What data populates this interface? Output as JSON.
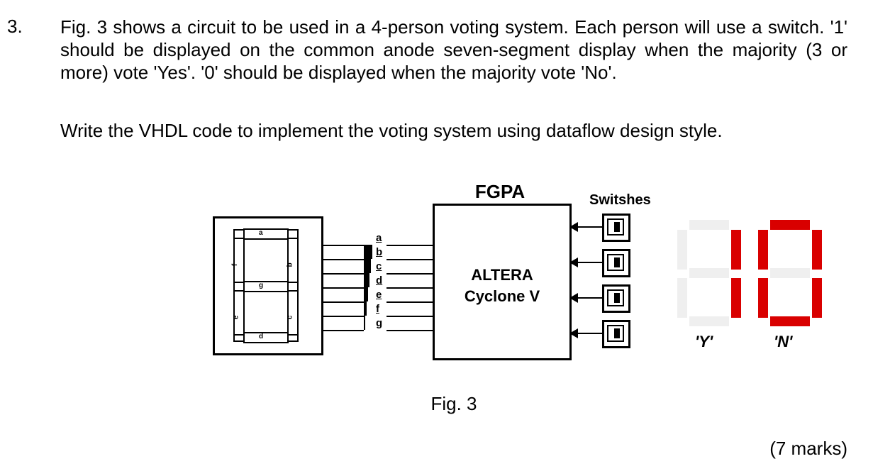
{
  "question": {
    "number": "3.",
    "para1": "Fig. 3 shows a circuit to be used in a 4-person voting system. Each person will use a switch. '1' should be displayed on the common anode seven-segment display when the majority (3 or more) vote 'Yes'. '0' should be displayed when the majority vote 'No'.",
    "para2": "Write the VHDL code to implement the voting system using dataflow design style."
  },
  "diagram": {
    "fpga_label": "FGPA",
    "fpga_line1": "ALTERA",
    "fpga_line2": "Cyclone V",
    "switches_label": "Switshes",
    "segment_outputs": [
      "a",
      "b",
      "c",
      "d",
      "e",
      "f",
      "g"
    ],
    "seven_seg_schematic": {
      "segments": [
        "a",
        "b",
        "c",
        "d",
        "e",
        "f",
        "g"
      ]
    },
    "display_digits": [
      {
        "caption": "'Y'",
        "on_segments": [
          "b",
          "c"
        ]
      },
      {
        "caption": "'N'",
        "on_segments": [
          "a",
          "b",
          "c",
          "d",
          "e",
          "f"
        ]
      }
    ],
    "caption": "Fig. 3"
  },
  "marks": "(7 marks)"
}
